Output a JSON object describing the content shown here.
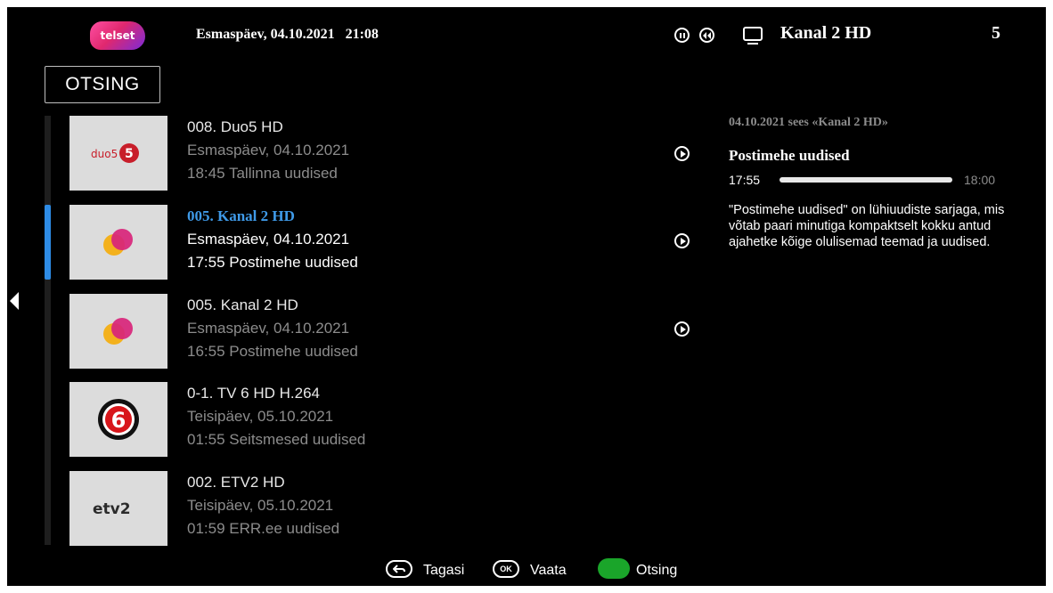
{
  "header": {
    "logo_text": "telset",
    "datetime": "Esmaspäev, 04.10.2021   21:08",
    "channel_name": "Kanal 2 HD",
    "channel_number": "5"
  },
  "search": {
    "label": "OTSING"
  },
  "list": [
    {
      "title": "008. Duo5 HD",
      "date": "Esmaspäev, 04.10.2021",
      "program": "18:45 Tallinna uudised",
      "logo": "duo5-logo",
      "selected": false
    },
    {
      "title": "005. Kanal 2 HD",
      "date": "Esmaspäev, 04.10.2021",
      "program": "17:55 Postimehe uudised",
      "logo": "kanal2-logo",
      "selected": true
    },
    {
      "title": "005. Kanal 2 HD",
      "date": "Esmaspäev, 04.10.2021",
      "program": "16:55 Postimehe uudised",
      "logo": "kanal2-logo",
      "selected": false
    },
    {
      "title": "0-1. TV 6 HD H.264",
      "date": "Teisipäev, 05.10.2021",
      "program": "01:55 Seitsmesed uudised",
      "logo": "tv6-logo",
      "selected": false
    },
    {
      "title": "002. ETV2 HD",
      "date": "Teisipäev, 05.10.2021",
      "program": "01:59 ERR.ee uudised",
      "logo": "etv2-logo",
      "selected": false
    }
  ],
  "logos": {
    "duo5": "duo5",
    "etv2": "etv2"
  },
  "detail": {
    "heading": "04.10.2021 sees «Kanal 2 HD»",
    "title": "Postimehe uudised",
    "start": "17:55",
    "end": "18:00",
    "progress": 1.0,
    "description": "\"Postimehe uudised\" on lühiuudiste sarjaga, mis võtab paari minutiga kompaktselt kokku antud ajahetke kõige olulisemad teemad ja uudised."
  },
  "footer": {
    "back_label": "Tagasi",
    "ok_icon": "OK",
    "watch_label": "Vaata",
    "search_label": "Otsing"
  },
  "colors": {
    "accent": "#3f9ae8",
    "green": "#1aa52a",
    "background": "#000000"
  }
}
